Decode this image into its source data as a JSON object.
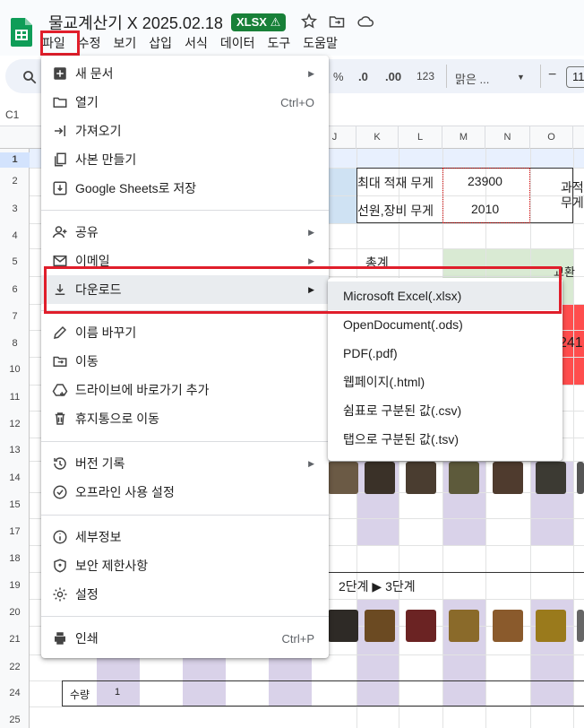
{
  "doc": {
    "title": "물교계산기 X 2025.02.18",
    "badge": "XLSX ⚠"
  },
  "menubar": [
    "파일",
    "수정",
    "보기",
    "삽입",
    "서식",
    "데이터",
    "도구",
    "도움말"
  ],
  "toolbar": {
    "percent": "%",
    "dec_decrease": ".0",
    "dec_increase": ".00",
    "format123": "123",
    "font": "맑은 ...",
    "minus": "−",
    "font_size": "11"
  },
  "namebox": "C1",
  "columns": [
    "J",
    "K",
    "L",
    "M",
    "N",
    "O"
  ],
  "rows": [
    "1",
    "2",
    "3",
    "4",
    "5",
    "6",
    "7",
    "8",
    "10",
    "11",
    "12",
    "13",
    "14",
    "15",
    "17",
    "18",
    "19",
    "20",
    "21",
    "22",
    "24",
    "25"
  ],
  "cells": {
    "max_load_label": "최대 적재 무게",
    "max_load_value": "23900",
    "crew_weight_label": "선원,장비 무게",
    "crew_weight_value": "2010",
    "overload_label": "과적",
    "weight_label": "무게",
    "total_label": "총계",
    "exchange_label": "교환",
    "number_241": "241",
    "stage_label": "2단계 ▶ 3단계",
    "qty_label": "수량",
    "qty_value": "1"
  },
  "file_menu": {
    "items": [
      {
        "label": "새 문서",
        "icon": "new-doc-icon",
        "submenu": true
      },
      {
        "label": "열기",
        "icon": "folder-open-icon",
        "shortcut": "Ctrl+O"
      },
      {
        "label": "가져오기",
        "icon": "import-icon"
      },
      {
        "label": "사본 만들기",
        "icon": "copy-icon"
      },
      {
        "label": "Google Sheets로 저장",
        "icon": "save-icon"
      },
      {
        "label": "공유",
        "icon": "share-person-icon",
        "submenu": true
      },
      {
        "label": "이메일",
        "icon": "email-icon",
        "submenu": true
      },
      {
        "label": "다운로드",
        "icon": "download-icon",
        "submenu": true,
        "highlighted": true
      },
      {
        "label": "이름 바꾸기",
        "icon": "pencil-icon"
      },
      {
        "label": "이동",
        "icon": "move-folder-icon"
      },
      {
        "label": "드라이브에 바로가기 추가",
        "icon": "drive-shortcut-icon"
      },
      {
        "label": "휴지통으로 이동",
        "icon": "trash-icon"
      },
      {
        "label": "버전 기록",
        "icon": "history-icon",
        "submenu": true
      },
      {
        "label": "오프라인 사용 설정",
        "icon": "offline-icon"
      },
      {
        "label": "세부정보",
        "icon": "info-icon"
      },
      {
        "label": "보안 제한사항",
        "icon": "shield-icon"
      },
      {
        "label": "설정",
        "icon": "gear-icon"
      },
      {
        "label": "인쇄",
        "icon": "print-icon",
        "shortcut": "Ctrl+P"
      }
    ]
  },
  "download_submenu": {
    "items": [
      {
        "label": "Microsoft Excel(.xlsx)",
        "highlighted": true
      },
      {
        "label": "OpenDocument(.ods)"
      },
      {
        "label": "PDF(.pdf)"
      },
      {
        "label": "웹페이지(.html)"
      },
      {
        "label": "쉼표로 구분된 값(.csv)"
      },
      {
        "label": "탭으로 구분된 값(.tsv)"
      }
    ]
  },
  "colors": {
    "accent_green": "#188038",
    "highlight_red": "#e01e2b",
    "purple_cell": "#d9d2e9",
    "light_green": "#d9ead3",
    "light_blue": "#cfe2f3",
    "red_cell": "#ff4d4d"
  }
}
